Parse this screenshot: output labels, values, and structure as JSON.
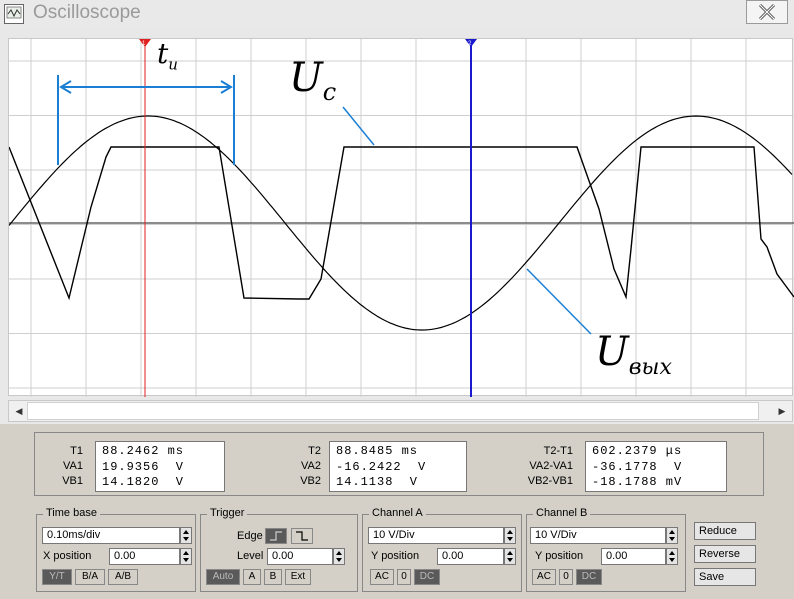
{
  "window": {
    "title": "Oscilloscope"
  },
  "readouts": {
    "col1": {
      "labels": [
        "T1",
        "VA1",
        "VB1"
      ],
      "values": [
        "88.2462 ms",
        "19.9356  V",
        "14.1820  V"
      ]
    },
    "col2": {
      "labels": [
        "T2",
        "VA2",
        "VB2"
      ],
      "values": [
        "88.8485 ms",
        "-16.2422  V",
        "14.1138  V"
      ]
    },
    "col3": {
      "labels": [
        "T2-T1",
        "VA2-VA1",
        "VB2-VB1"
      ],
      "values": [
        "602.2379 μs",
        "-36.1778  V",
        "-18.1788 mV"
      ]
    }
  },
  "timebase": {
    "title": "Time base",
    "value": "0.10ms/div",
    "xpos_label": "X position",
    "xpos_value": "0.00",
    "modes": [
      "Y/T",
      "B/A",
      "A/B"
    ]
  },
  "trigger": {
    "title": "Trigger",
    "edge_label": "Edge",
    "level_label": "Level",
    "level_value": "0.00",
    "modes": [
      "Auto",
      "A",
      "B",
      "Ext"
    ]
  },
  "channel_a": {
    "title": "Channel A",
    "value": "10 V/Div",
    "ypos_label": "Y position",
    "ypos_value": "0.00",
    "couplings": [
      "AC",
      "0",
      "DC"
    ]
  },
  "channel_b": {
    "title": "Channel B",
    "value": "10 V/Div",
    "ypos_label": "Y position",
    "ypos_value": "0.00",
    "couplings": [
      "AC",
      "0",
      "DC"
    ]
  },
  "actions": {
    "reduce": "Reduce",
    "reverse": "Reverse",
    "save": "Save"
  },
  "annotations": {
    "t_main": "t",
    "t_sub": "u",
    "uc_main": "U",
    "uc_sub": "c",
    "uvyx_main": "U",
    "uvyx_sub": "вых"
  },
  "cursors": {
    "t1_marker": "1",
    "t2_marker": "2",
    "t1_color": "#e02020",
    "t2_color": "#1a1acc"
  },
  "colors": {
    "annotation": "#1a7fd4",
    "trace": "#000000",
    "grid": "#c8c8c8"
  }
}
